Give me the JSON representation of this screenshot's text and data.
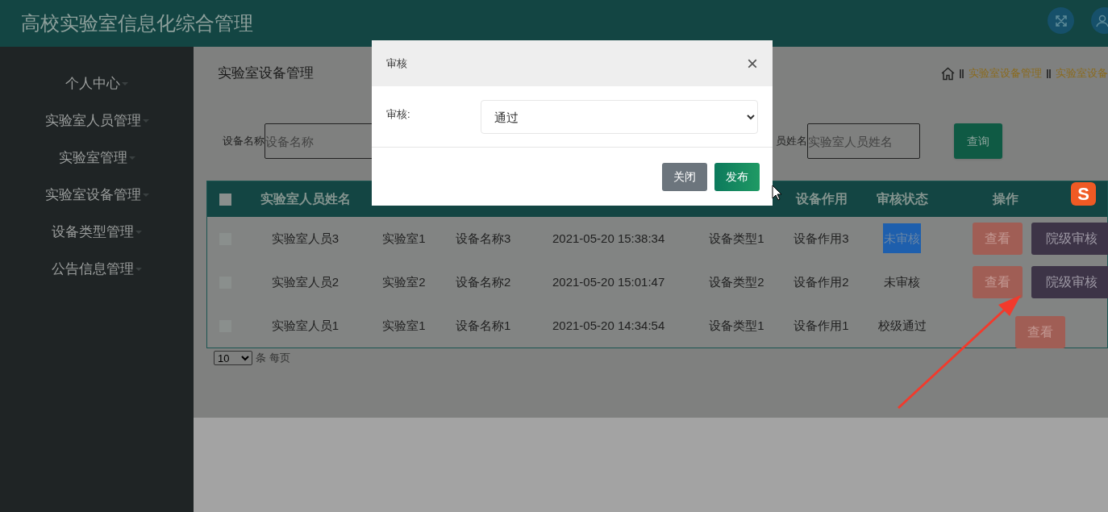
{
  "app_title": "高校实验室信息化综合管理",
  "sidebar": {
    "items": [
      {
        "label": "个人中心"
      },
      {
        "label": "实验室人员管理"
      },
      {
        "label": "实验室管理"
      },
      {
        "label": "实验室设备管理"
      },
      {
        "label": "设备类型管理"
      },
      {
        "label": "公告信息管理"
      }
    ]
  },
  "page_title": "实验室设备管理",
  "breadcrumb": [
    {
      "label": "实验室设备管理"
    },
    {
      "label": "实验室设备"
    }
  ],
  "search": {
    "fields": [
      {
        "label": "设备名称",
        "placeholder": "设备名称"
      },
      {
        "label": "员姓名",
        "placeholder": "实验室人员姓名"
      }
    ],
    "button": "查询"
  },
  "table": {
    "header_checked": false,
    "columns": [
      {
        "label": "实验室人员姓名"
      },
      {},
      {},
      {},
      {},
      {
        "label": "设备作用"
      },
      {
        "label": "审核状态"
      },
      {
        "label": "操作"
      }
    ],
    "rows": [
      {
        "cells": [
          "实验室人员3",
          "实验室1",
          "设备名称3",
          "2021-05-20 15:38:34",
          "设备类型1",
          "设备作用3",
          "未审核"
        ],
        "status_selected": true,
        "checked": false,
        "actions": [
          {
            "kind": "view",
            "label": "查看"
          },
          {
            "kind": "review",
            "label": "院级审核"
          }
        ]
      },
      {
        "cells": [
          "实验室人员2",
          "实验室2",
          "设备名称2",
          "2021-05-20 15:01:47",
          "设备类型2",
          "设备作用2",
          "未审核"
        ],
        "status_selected": false,
        "checked": false,
        "actions": [
          {
            "kind": "view",
            "label": "查看"
          },
          {
            "kind": "review",
            "label": "院级审核"
          }
        ]
      },
      {
        "cells": [
          "实验室人员1",
          "实验室1",
          "设备名称1",
          "2021-05-20 14:34:54",
          "设备类型1",
          "设备作用1",
          "校级通过"
        ],
        "status_selected": false,
        "checked": false,
        "actions": [
          {
            "kind": "view",
            "label": "查看"
          }
        ]
      }
    ]
  },
  "pagination": {
    "page_size": "10",
    "label": "条 每页"
  },
  "ime_badge": {
    "glyph": "S"
  },
  "modal": {
    "title": "审核",
    "close": "×",
    "field_label": "审核:",
    "field_value": "通过",
    "buttons": [
      {
        "kind": "secondary",
        "label": "关闭"
      },
      {
        "kind": "primary",
        "label": "发布"
      }
    ]
  }
}
